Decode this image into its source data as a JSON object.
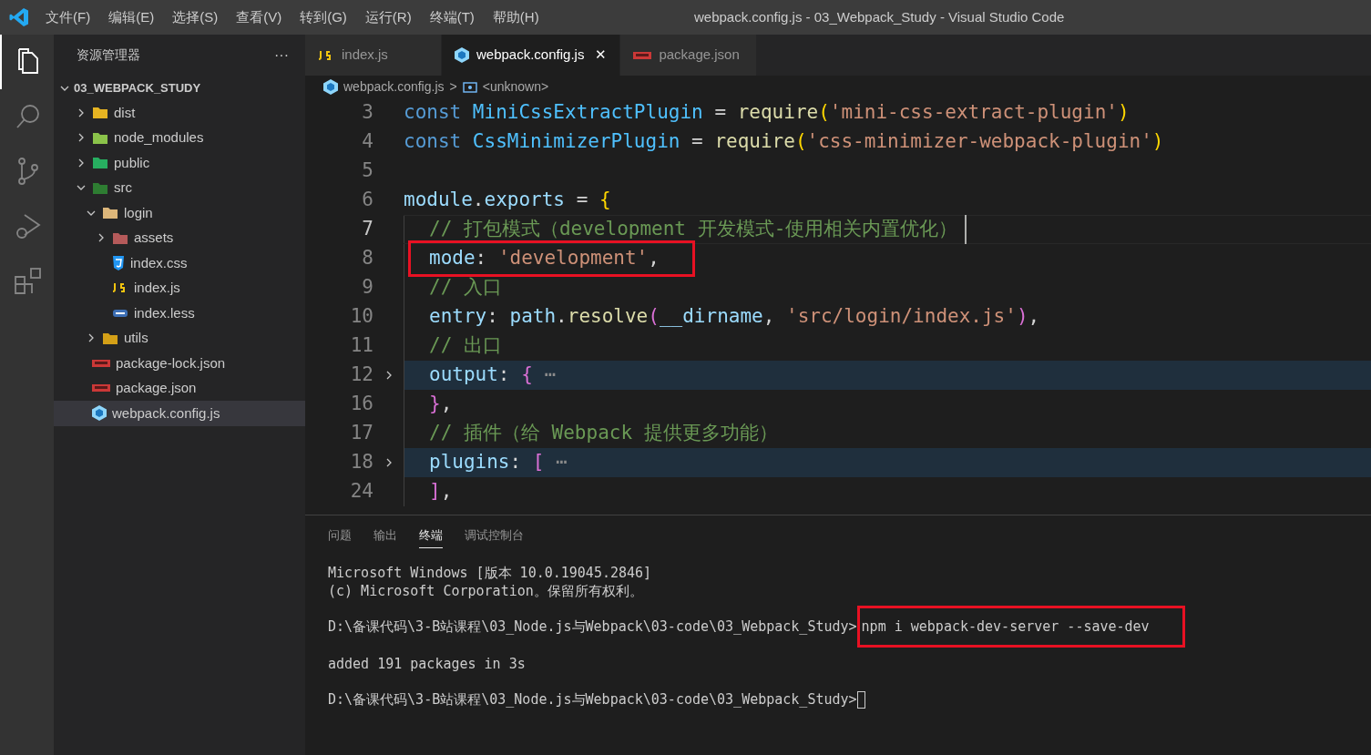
{
  "title_bar": {
    "menu": [
      "文件(F)",
      "编辑(E)",
      "选择(S)",
      "查看(V)",
      "转到(G)",
      "运行(R)",
      "终端(T)",
      "帮助(H)"
    ],
    "title": "webpack.config.js - 03_Webpack_Study - Visual Studio Code"
  },
  "activity_bar": [
    {
      "kind": "explorer",
      "selected": true
    },
    {
      "kind": "search",
      "selected": false
    },
    {
      "kind": "source-control",
      "selected": false
    },
    {
      "kind": "run-debug",
      "selected": false
    },
    {
      "kind": "extensions",
      "selected": false
    }
  ],
  "sidebar": {
    "title": "资源管理器",
    "more": "···",
    "root": "03_WEBPACK_STUDY",
    "items": [
      {
        "label": "dist",
        "kind": "folder",
        "color": "#e6b422",
        "expanded": false,
        "selected": false
      },
      {
        "label": "node_modules",
        "kind": "folder",
        "color": "#8bc34a",
        "expanded": false,
        "selected": false
      },
      {
        "label": "public",
        "kind": "folder",
        "color": "#27ae60",
        "expanded": false,
        "selected": false
      },
      {
        "label": "src",
        "kind": "folder",
        "color": "#2e7d32",
        "expanded": true,
        "selected": false,
        "children": [
          {
            "label": "login",
            "kind": "folder",
            "color": "#dcb67a",
            "expanded": true,
            "selected": false,
            "children": [
              {
                "label": "assets",
                "kind": "folder",
                "color": "#b55a5a",
                "expanded": false,
                "selected": false
              },
              {
                "label": "index.css",
                "kind": "css",
                "selected": false
              },
              {
                "label": "index.js",
                "kind": "js",
                "selected": false
              },
              {
                "label": "index.less",
                "kind": "less",
                "selected": false
              }
            ]
          },
          {
            "label": "utils",
            "kind": "folder",
            "color": "#d4a017",
            "expanded": false,
            "selected": false
          }
        ]
      },
      {
        "label": "package-lock.json",
        "kind": "npm",
        "selected": false
      },
      {
        "label": "package.json",
        "kind": "npm",
        "selected": false
      },
      {
        "label": "webpack.config.js",
        "kind": "webpack",
        "selected": true
      }
    ]
  },
  "tabs": [
    {
      "label": "index.js",
      "kind": "js",
      "selected": false
    },
    {
      "label": "webpack.config.js",
      "kind": "webpack",
      "selected": true,
      "close": "✕"
    },
    {
      "label": "package.json",
      "kind": "npm",
      "selected": false
    }
  ],
  "breadcrumb": {
    "file": "webpack.config.js",
    "separator": ">",
    "symbol": "<unknown>"
  },
  "editor": {
    "lines": [
      {
        "number": "3",
        "indented": false,
        "folded": false,
        "current": false,
        "highlight": false,
        "tokens": [
          {
            "kind": "keyword",
            "text": "const "
          },
          {
            "kind": "constant",
            "text": "MiniCssExtractPlugin"
          },
          {
            "kind": "op",
            "text": " = "
          },
          {
            "kind": "func",
            "text": "require"
          },
          {
            "kind": "paren1",
            "text": "("
          },
          {
            "kind": "string",
            "text": "'mini-css-extract-plugin'"
          },
          {
            "kind": "paren1",
            "text": ")"
          }
        ]
      },
      {
        "number": "4",
        "indented": false,
        "folded": false,
        "current": false,
        "highlight": false,
        "tokens": [
          {
            "kind": "keyword",
            "text": "const "
          },
          {
            "kind": "constant",
            "text": "CssMinimizerPlugin"
          },
          {
            "kind": "op",
            "text": " = "
          },
          {
            "kind": "func",
            "text": "require"
          },
          {
            "kind": "paren1",
            "text": "("
          },
          {
            "kind": "string",
            "text": "'css-minimizer-webpack-plugin'"
          },
          {
            "kind": "paren1",
            "text": ")"
          }
        ]
      },
      {
        "number": "5"
      },
      {
        "number": "6",
        "indented": false,
        "folded": false,
        "current": false,
        "highlight": false,
        "tokens": [
          {
            "kind": "var",
            "text": "module"
          },
          {
            "kind": "op",
            "text": "."
          },
          {
            "kind": "var",
            "text": "exports"
          },
          {
            "kind": "op",
            "text": " = "
          },
          {
            "kind": "paren1",
            "text": "{"
          }
        ]
      },
      {
        "number": "7",
        "indented": true,
        "folded": false,
        "current": true,
        "highlight": false,
        "tokens": [
          {
            "kind": "comment",
            "text": "// 打包模式（development 开发模式-使用相关内置优化）"
          }
        ]
      },
      {
        "number": "8",
        "indented": true,
        "folded": false,
        "current": false,
        "highlight": true,
        "tokens": [
          {
            "kind": "var",
            "text": "mode"
          },
          {
            "kind": "op",
            "text": ": "
          },
          {
            "kind": "string",
            "text": "'development'"
          },
          {
            "kind": "op",
            "text": ","
          }
        ]
      },
      {
        "number": "9",
        "indented": true,
        "folded": false,
        "current": false,
        "highlight": false,
        "tokens": [
          {
            "kind": "comment",
            "text": "// 入口"
          }
        ]
      },
      {
        "number": "10",
        "indented": true,
        "folded": false,
        "current": false,
        "highlight": false,
        "tokens": [
          {
            "kind": "var",
            "text": "entry"
          },
          {
            "kind": "op",
            "text": ": "
          },
          {
            "kind": "var",
            "text": "path"
          },
          {
            "kind": "op",
            "text": "."
          },
          {
            "kind": "func",
            "text": "resolve"
          },
          {
            "kind": "paren2",
            "text": "("
          },
          {
            "kind": "var",
            "text": "__dirname"
          },
          {
            "kind": "op",
            "text": ", "
          },
          {
            "kind": "string",
            "text": "'src/login/index.js'"
          },
          {
            "kind": "paren2",
            "text": ")"
          },
          {
            "kind": "op",
            "text": ","
          }
        ]
      },
      {
        "number": "11",
        "indented": true,
        "folded": false,
        "current": false,
        "highlight": false,
        "tokens": [
          {
            "kind": "comment",
            "text": "// 出口"
          }
        ]
      },
      {
        "number": "12",
        "indented": true,
        "folded": true,
        "current": false,
        "highlight": false,
        "tokens": [
          {
            "kind": "var",
            "text": "output"
          },
          {
            "kind": "op",
            "text": ": "
          },
          {
            "kind": "paren2",
            "text": "{"
          },
          {
            "kind": "fold",
            "text": " ⋯"
          }
        ]
      },
      {
        "number": "16",
        "indented": true,
        "folded": false,
        "current": false,
        "highlight": false,
        "tokens": [
          {
            "kind": "paren2",
            "text": "}"
          },
          {
            "kind": "op",
            "text": ","
          }
        ]
      },
      {
        "number": "17",
        "indented": true,
        "folded": false,
        "current": false,
        "highlight": false,
        "tokens": [
          {
            "kind": "comment",
            "text": "// 插件（给 Webpack 提供更多功能）"
          }
        ]
      },
      {
        "number": "18",
        "indented": true,
        "folded": true,
        "current": false,
        "highlight": false,
        "tokens": [
          {
            "kind": "var",
            "text": "plugins"
          },
          {
            "kind": "op",
            "text": ": "
          },
          {
            "kind": "paren2",
            "text": "["
          },
          {
            "kind": "fold",
            "text": " ⋯"
          }
        ]
      },
      {
        "number": "24",
        "indented": true,
        "folded": false,
        "current": false,
        "highlight": false,
        "tokens": [
          {
            "kind": "paren2",
            "text": "]"
          },
          {
            "kind": "op",
            "text": ","
          }
        ]
      }
    ]
  },
  "panel": {
    "tabs": [
      {
        "label": "问题",
        "selected": false
      },
      {
        "label": "输出",
        "selected": false
      },
      {
        "label": "终端",
        "selected": true
      },
      {
        "label": "调试控制台",
        "selected": false
      }
    ],
    "blocks": [
      [
        {
          "text": "Microsoft Windows [版本 10.0.19045.2846]"
        },
        {
          "text": "(c) Microsoft Corporation。保留所有权利。"
        }
      ],
      [
        {
          "prompt": "D:\\备课代码\\3-B站课程\\03_Node.js与Webpack\\03-code\\03_Webpack_Study>",
          "command": "npm i webpack-dev-server --save-dev",
          "highlight": true
        }
      ],
      [
        {
          "text": "added 191 packages in 3s"
        }
      ],
      [
        {
          "prompt": "D:\\备课代码\\3-B站课程\\03_Node.js与Webpack\\03-code\\03_Webpack_Study>",
          "cursor": true
        }
      ]
    ]
  }
}
